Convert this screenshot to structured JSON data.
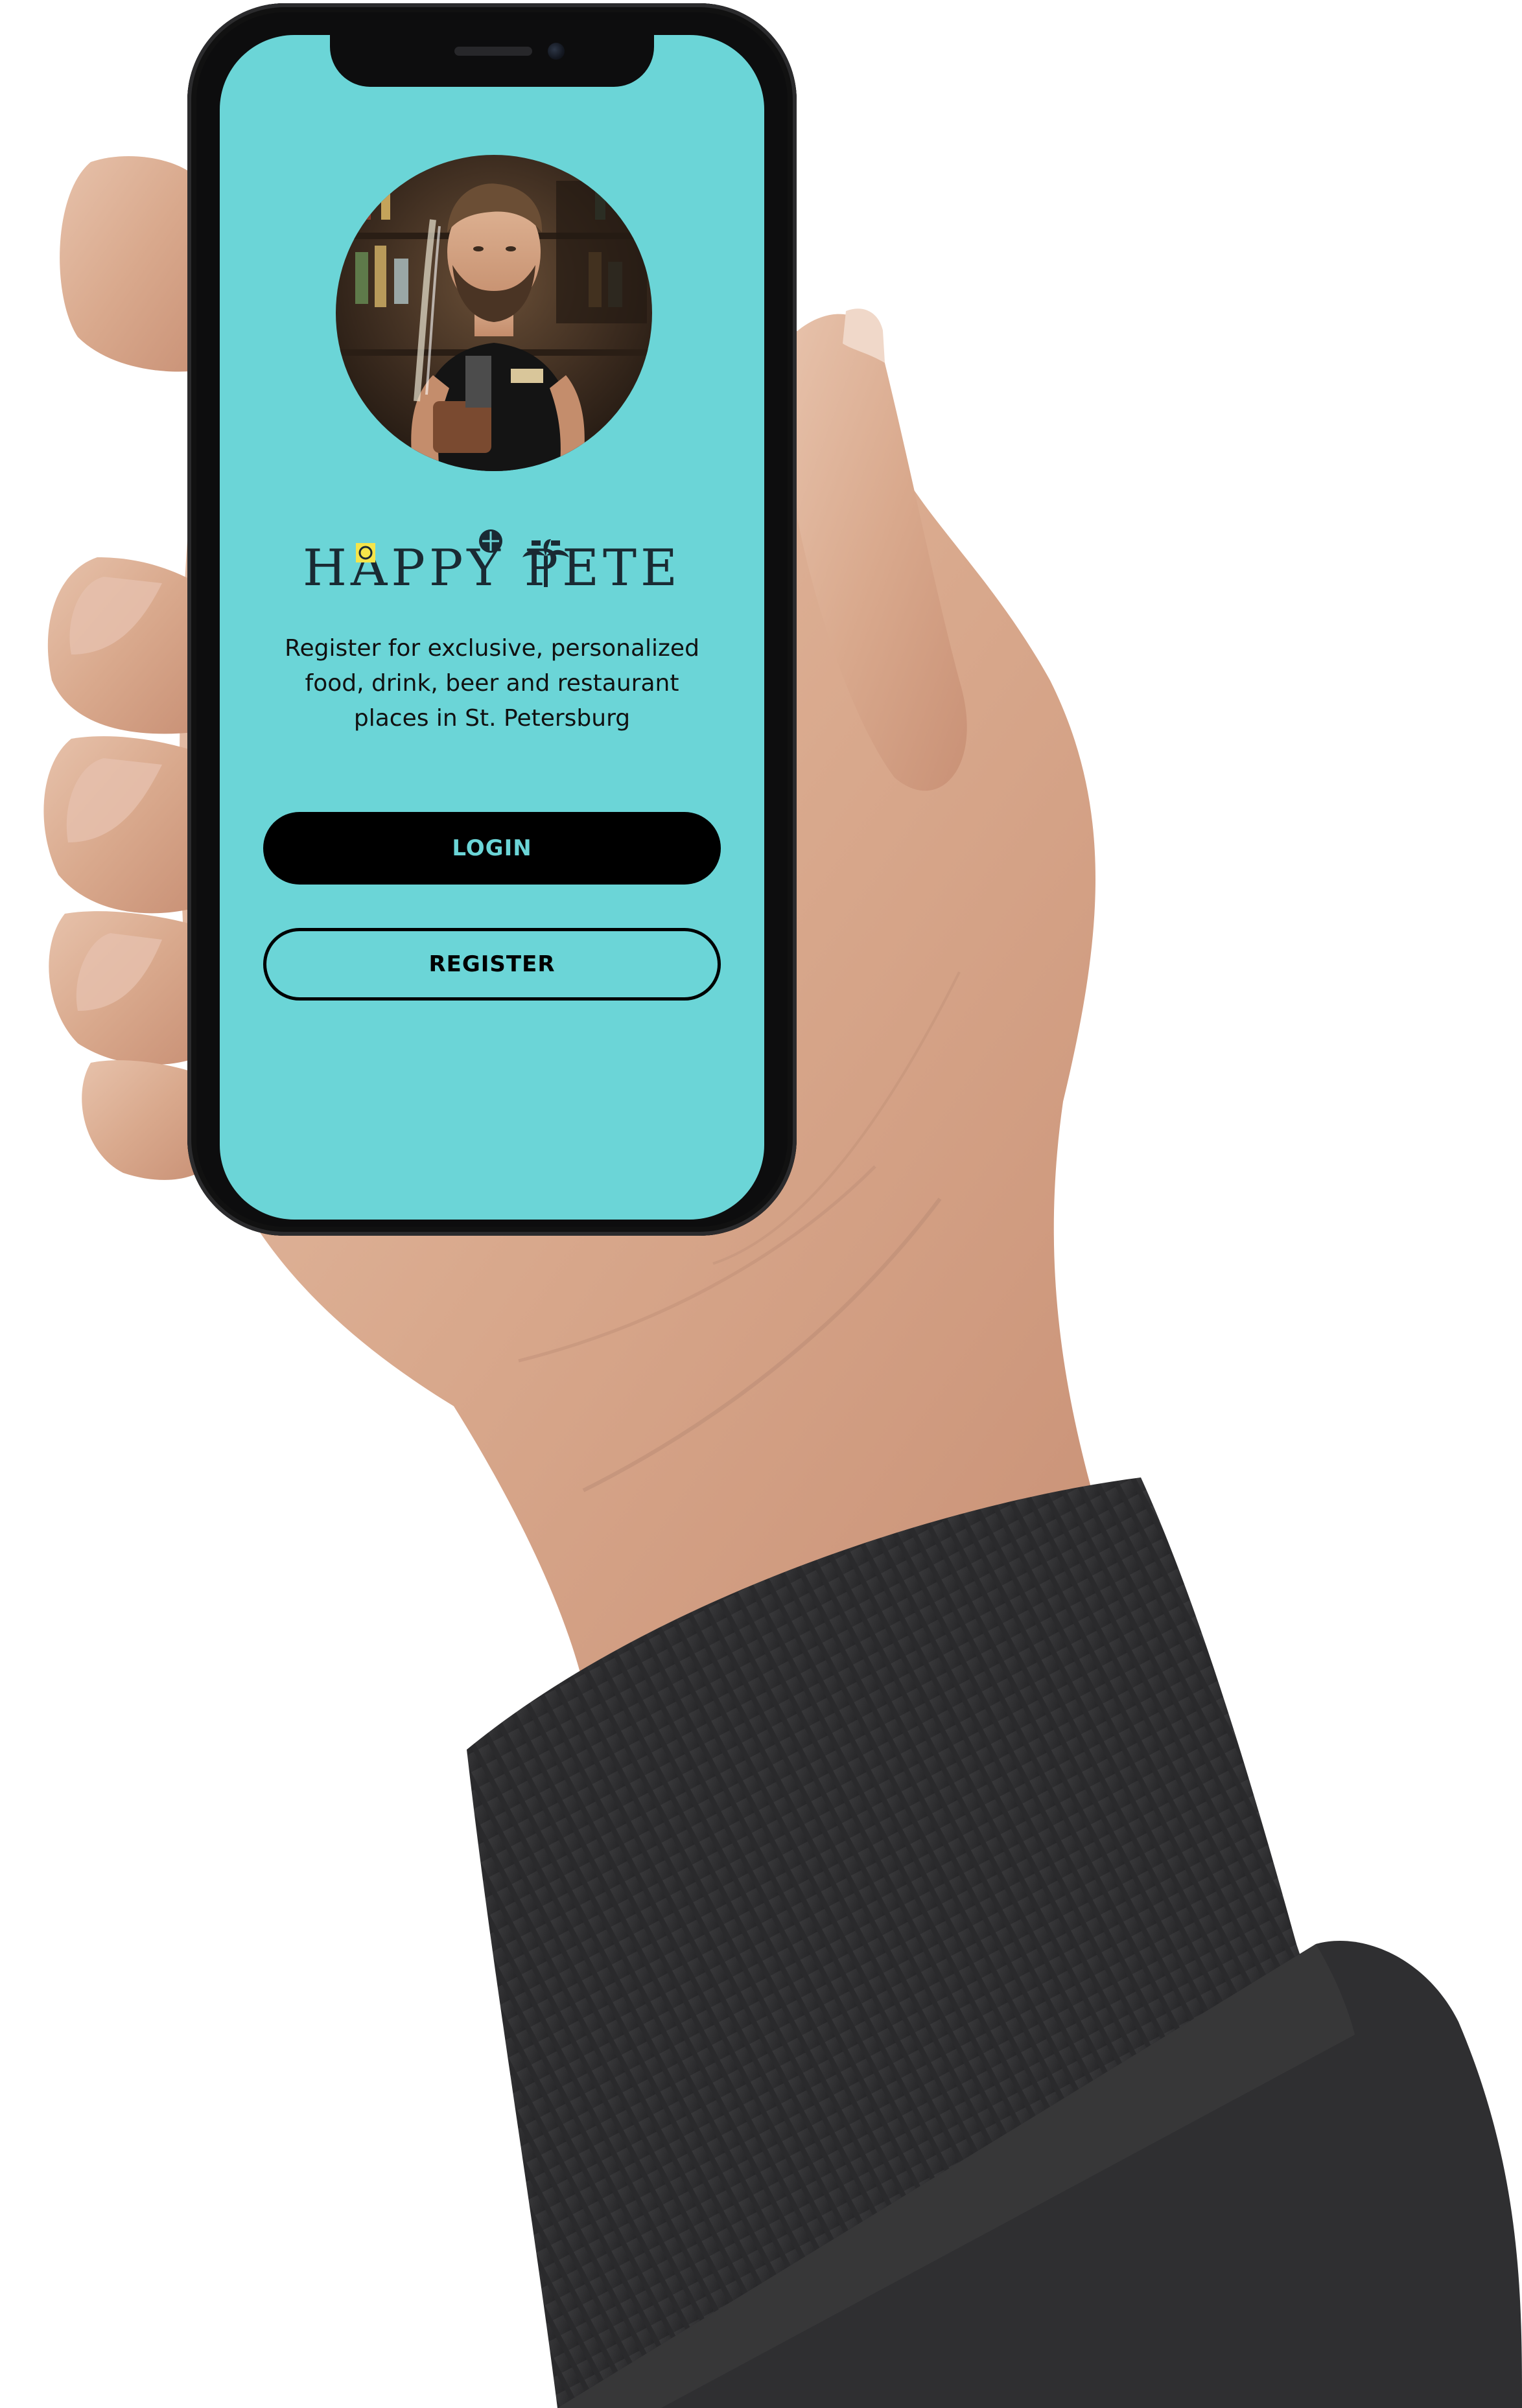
{
  "app": {
    "logo_text": "HAPPY PETE",
    "tagline": "Register for exclusive, personalized food, drink, beer and restaurant places in St. Petersburg"
  },
  "actions": {
    "login_label": "LOGIN",
    "register_label": "REGISTER"
  },
  "colors": {
    "screen_background": "#6bd5d7",
    "login_button_background": "#000000",
    "login_button_text": "#6bd5d7",
    "register_button_border": "#000000",
    "logo_accent": "#f5e54a"
  },
  "icons": {
    "avatar": "bartender-photo",
    "logo_decorations": [
      "lime-icon",
      "cocktail-icon",
      "palm-tree-icon"
    ]
  }
}
